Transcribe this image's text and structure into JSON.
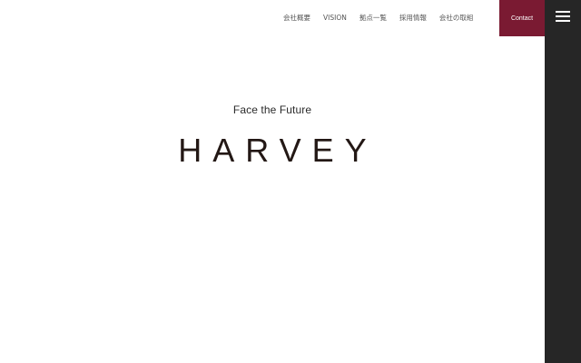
{
  "nav": {
    "items": [
      {
        "label": "会社概要"
      },
      {
        "label": "VISION"
      },
      {
        "label": "拠点一覧"
      },
      {
        "label": "採用情報"
      },
      {
        "label": "会社の取組"
      }
    ]
  },
  "contact": {
    "label": "Contact",
    "color": "#7a1a32"
  },
  "sidebar": {
    "menu_icon": "hamburger-menu-icon",
    "color": "#262626"
  },
  "hero": {
    "tagline": "Face the Future",
    "logo_text": "HARVEY"
  }
}
